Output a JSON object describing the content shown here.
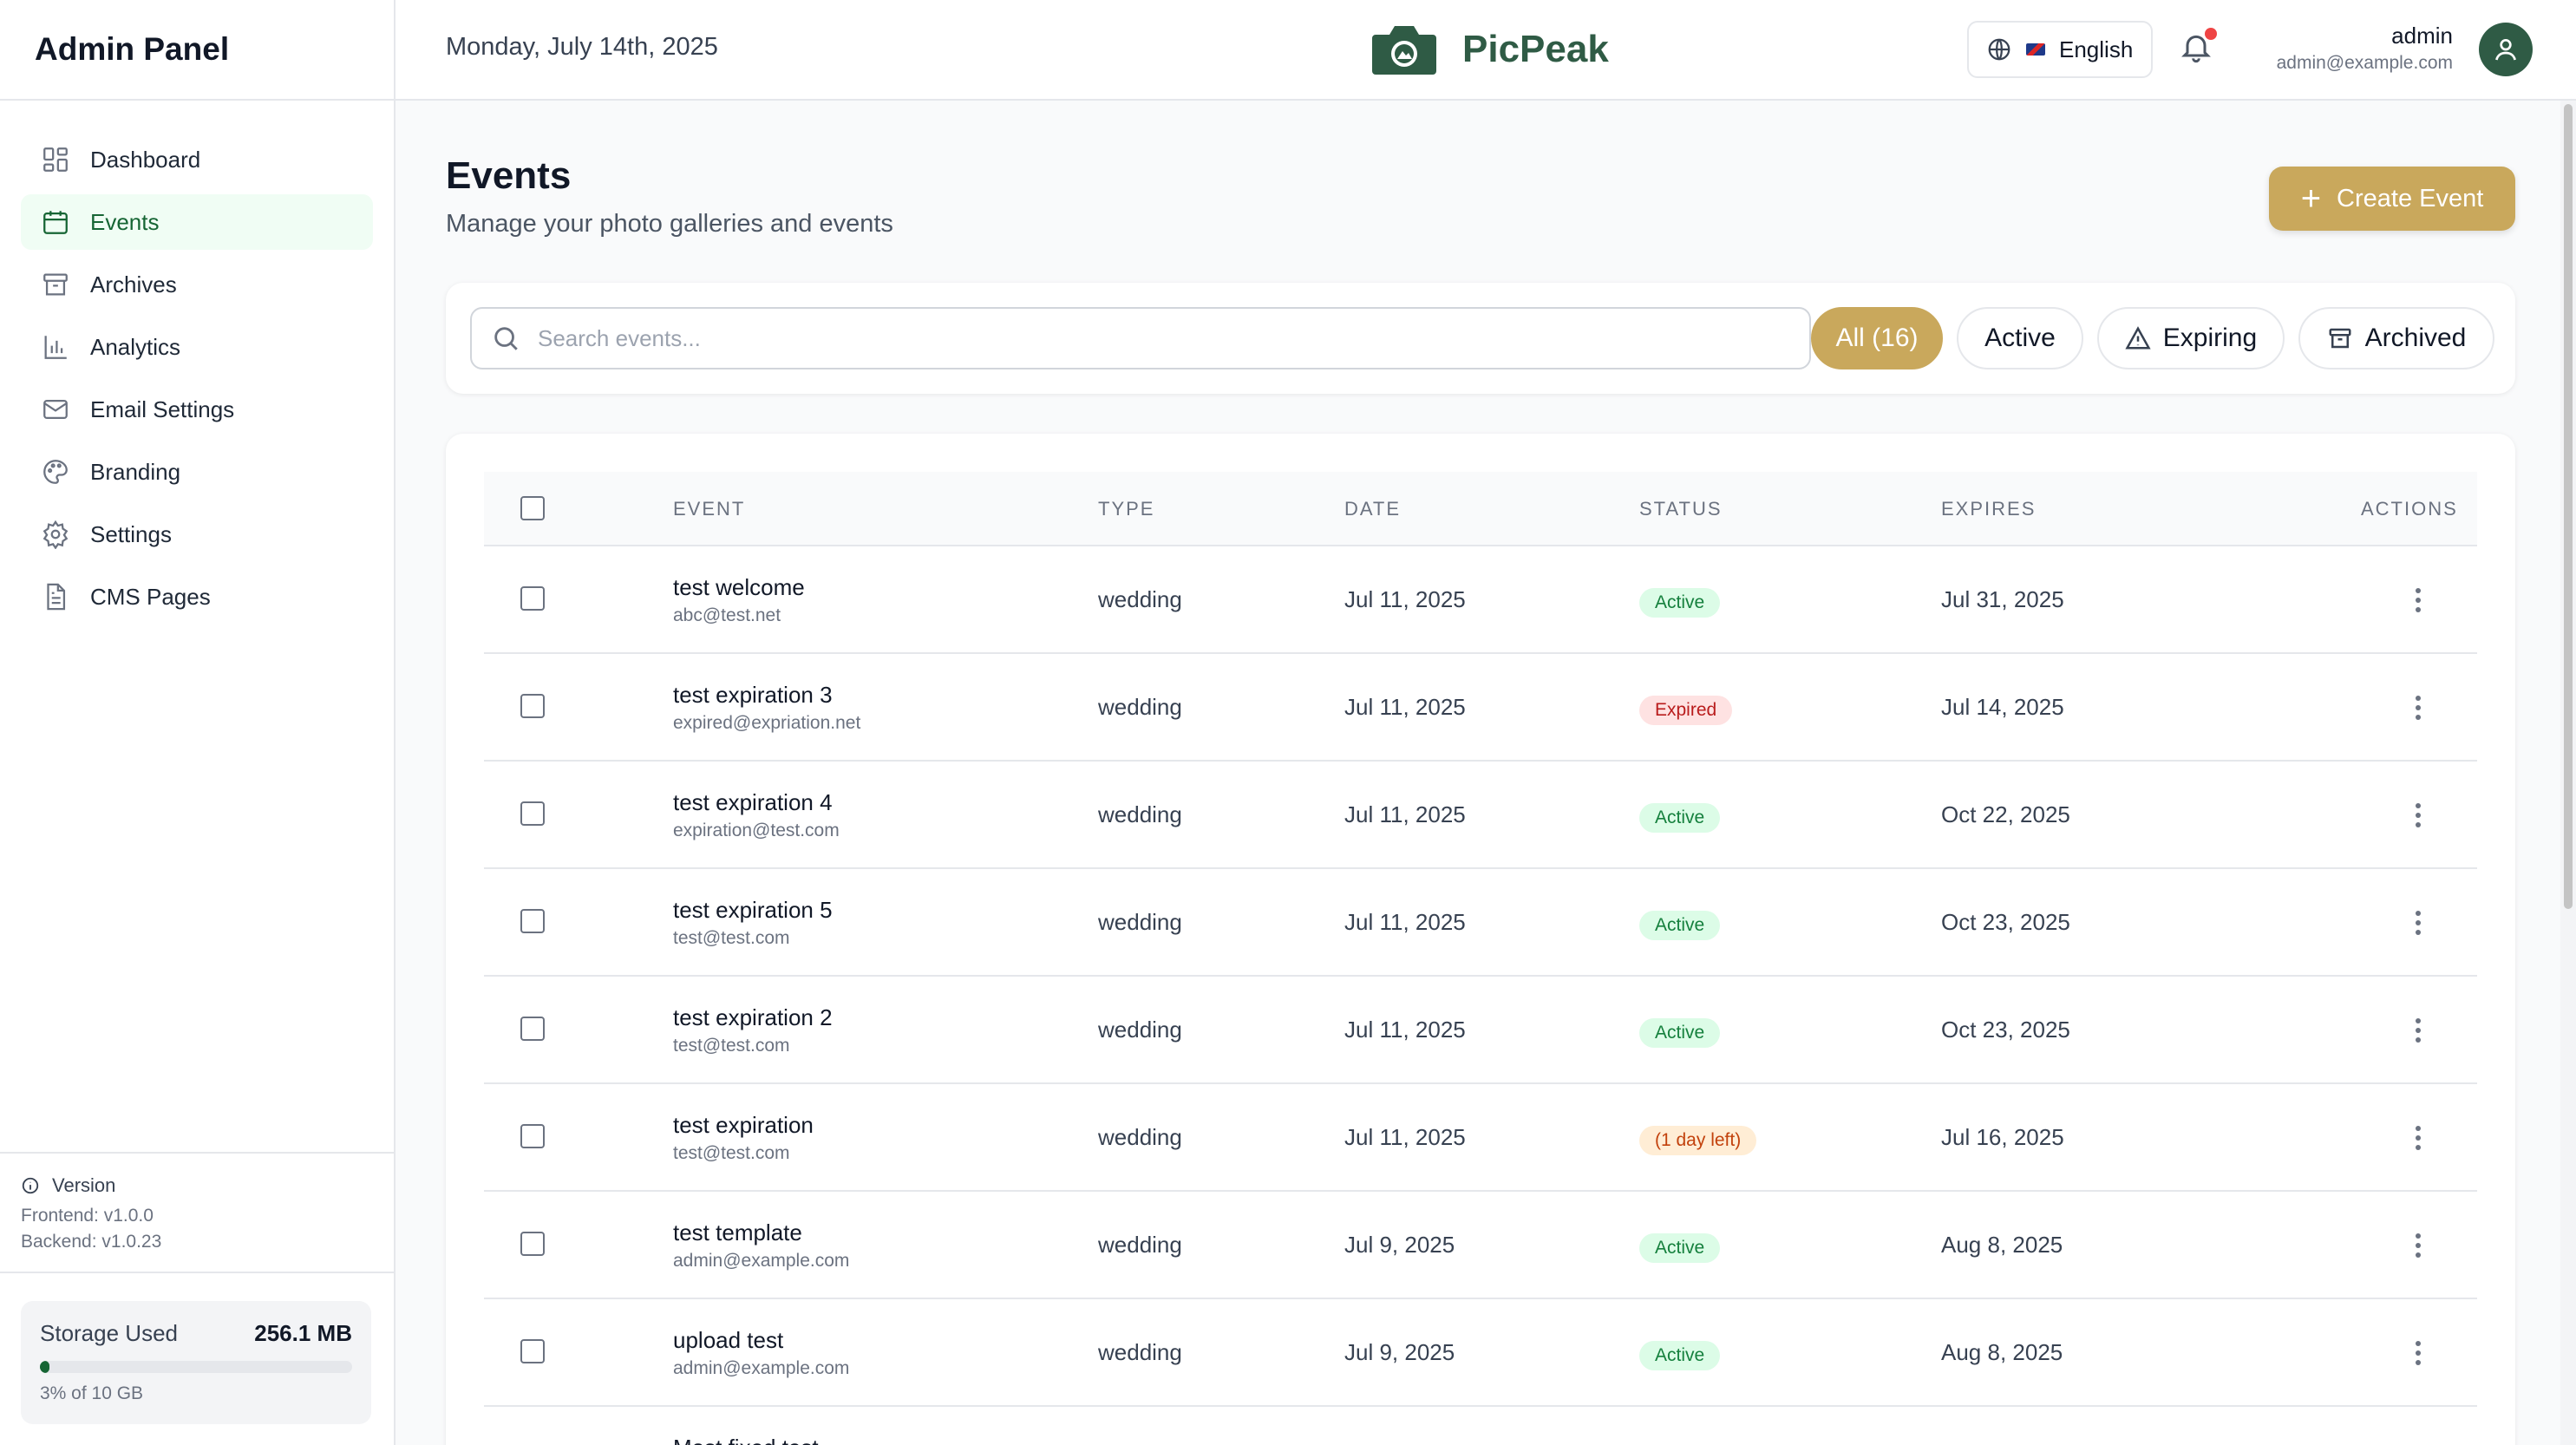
{
  "sidebar": {
    "title": "Admin Panel",
    "items": [
      {
        "label": "Dashboard",
        "icon": "dashboard-icon"
      },
      {
        "label": "Events",
        "icon": "calendar-icon",
        "active": true
      },
      {
        "label": "Archives",
        "icon": "archive-icon"
      },
      {
        "label": "Analytics",
        "icon": "bar-chart-icon"
      },
      {
        "label": "Email Settings",
        "icon": "mail-icon"
      },
      {
        "label": "Branding",
        "icon": "palette-icon"
      },
      {
        "label": "Settings",
        "icon": "gear-icon"
      },
      {
        "label": "CMS Pages",
        "icon": "file-text-icon"
      }
    ],
    "version": {
      "heading": "Version",
      "frontend": "Frontend: v1.0.0",
      "backend": "Backend: v1.0.23"
    },
    "storage": {
      "label": "Storage Used",
      "value": "256.1 MB",
      "percent_text": "3% of 10 GB",
      "percent": 3
    }
  },
  "header": {
    "date": "Monday, July 14th, 2025",
    "brand": "PicPeak",
    "language": "English",
    "user_name": "admin",
    "user_email": "admin@example.com"
  },
  "page": {
    "title": "Events",
    "subtitle": "Manage your photo galleries and events",
    "create_label": "Create Event"
  },
  "filters": {
    "search_placeholder": "Search events...",
    "all": "All (16)",
    "active": "Active",
    "expiring": "Expiring",
    "archived": "Archived"
  },
  "table": {
    "headers": {
      "event": "EVENT",
      "type": "TYPE",
      "date": "DATE",
      "status": "STATUS",
      "expires": "EXPIRES",
      "actions": "ACTIONS"
    },
    "rows": [
      {
        "name": "test welcome",
        "email": "abc@test.net",
        "type": "wedding",
        "date": "Jul 11, 2025",
        "status": "Active",
        "status_kind": "active",
        "expires": "Jul 31, 2025"
      },
      {
        "name": "test expiration 3",
        "email": "expired@expriation.net",
        "type": "wedding",
        "date": "Jul 11, 2025",
        "status": "Expired",
        "status_kind": "expired",
        "expires": "Jul 14, 2025"
      },
      {
        "name": "test expiration 4",
        "email": "expiration@test.com",
        "type": "wedding",
        "date": "Jul 11, 2025",
        "status": "Active",
        "status_kind": "active",
        "expires": "Oct 22, 2025"
      },
      {
        "name": "test expiration 5",
        "email": "test@test.com",
        "type": "wedding",
        "date": "Jul 11, 2025",
        "status": "Active",
        "status_kind": "active",
        "expires": "Oct 23, 2025"
      },
      {
        "name": "test expiration 2",
        "email": "test@test.com",
        "type": "wedding",
        "date": "Jul 11, 2025",
        "status": "Active",
        "status_kind": "active",
        "expires": "Oct 23, 2025"
      },
      {
        "name": "test expiration",
        "email": "test@test.com",
        "type": "wedding",
        "date": "Jul 11, 2025",
        "status": "(1 day left)",
        "status_kind": "warn",
        "expires": "Jul 16, 2025"
      },
      {
        "name": "test template",
        "email": "admin@example.com",
        "type": "wedding",
        "date": "Jul 9, 2025",
        "status": "Active",
        "status_kind": "active",
        "expires": "Aug 8, 2025"
      },
      {
        "name": "upload test",
        "email": "admin@example.com",
        "type": "wedding",
        "date": "Jul 9, 2025",
        "status": "Active",
        "status_kind": "active",
        "expires": "Aug 8, 2025"
      },
      {
        "name": "Most fixed test",
        "email": "",
        "type": "",
        "date": "",
        "status": "",
        "status_kind": "active",
        "expires": ""
      }
    ]
  },
  "colors": {
    "accent": "#c9a85c",
    "brand": "#2f5b45",
    "active_nav_bg": "#f0fdf4",
    "active_nav_text": "#166534"
  }
}
